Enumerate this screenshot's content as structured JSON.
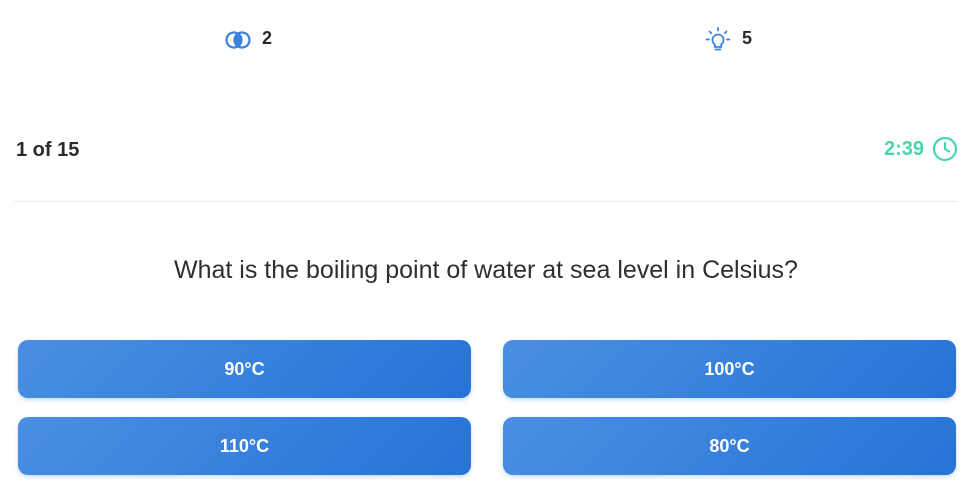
{
  "lifelines": {
    "fifty_fifty": {
      "icon": "fifty-fifty-icon",
      "count": "2"
    },
    "hint": {
      "icon": "lightbulb-icon",
      "count": "5"
    }
  },
  "progress": {
    "label": "1 of 15"
  },
  "timer": {
    "value": "2:39",
    "icon": "clock-icon",
    "color": "#48d6b0"
  },
  "question": {
    "text": "What is the boiling point of water at sea level in Celsius?"
  },
  "answers": [
    {
      "label": "90°C"
    },
    {
      "label": "100°C"
    },
    {
      "label": "110°C"
    },
    {
      "label": "80°C"
    }
  ],
  "colors": {
    "accent": "#2673d6",
    "accent_light": "#4a8fe2",
    "icon_blue": "#3b82e0"
  }
}
